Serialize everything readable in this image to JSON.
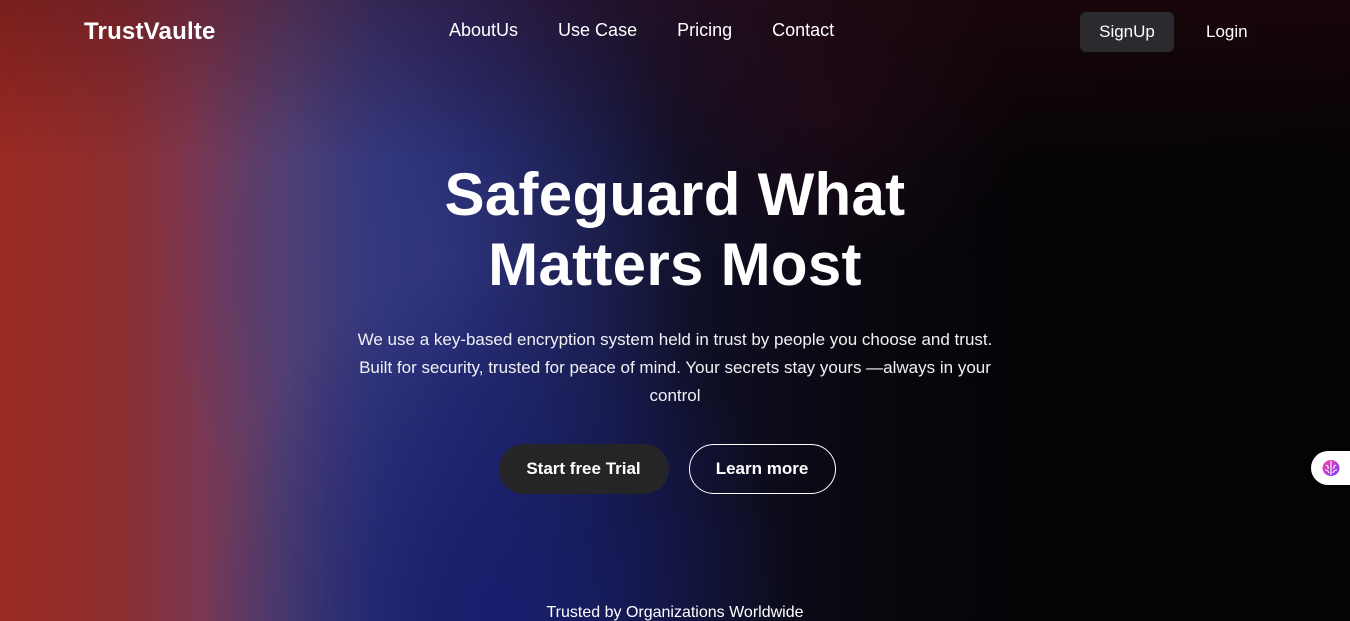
{
  "brand": {
    "name": "TrustVaulte"
  },
  "nav": {
    "links": [
      "AboutUs",
      "Use Case",
      "Pricing",
      "Contact"
    ],
    "signup_label": "SignUp",
    "login_label": "Login"
  },
  "hero": {
    "title_line1": "Safeguard What",
    "title_line2": "Matters Most",
    "description": "We use a key-based encryption system held in trust by people you choose and trust. Built for security, trusted for peace of mind. Your secrets stay yours —always in your control",
    "primary_cta": "Start free Trial",
    "secondary_cta": "Learn more"
  },
  "trusted_text": "Trusted by Organizations Worldwide",
  "widget": {
    "icon": "brain-icon"
  },
  "colors": {
    "signup_bg": "#2b2a2e",
    "primary_btn_bg": "#252528",
    "gradient_left": "#9a2a22",
    "gradient_mid": "#1c2562",
    "gradient_right": "#050306"
  }
}
